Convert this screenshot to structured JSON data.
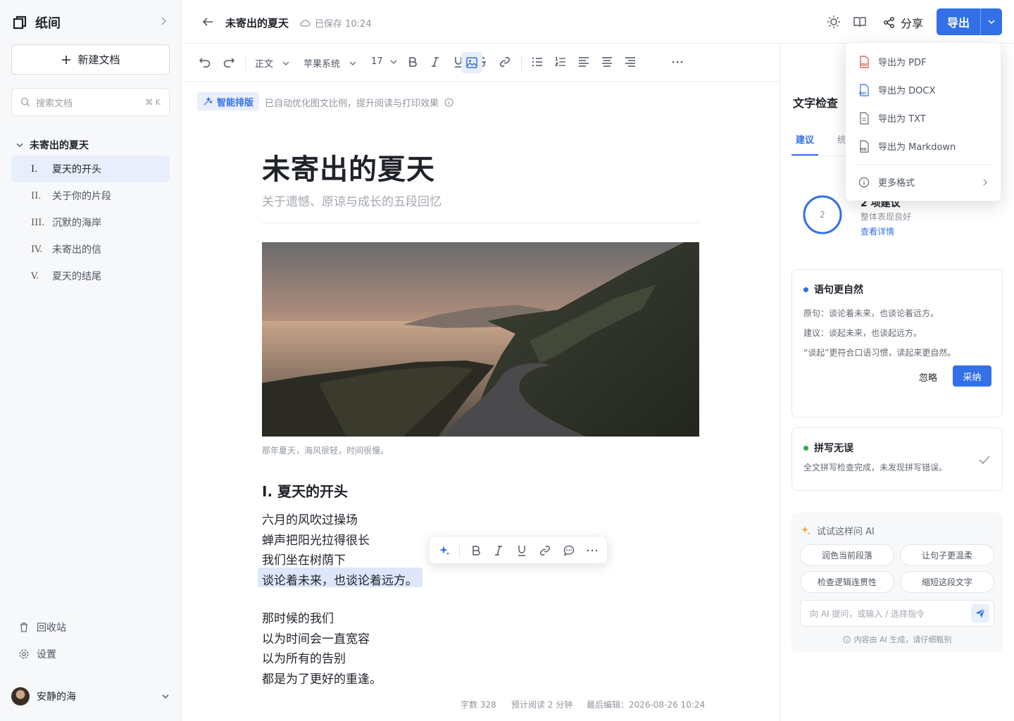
{
  "app": {
    "name": "纸间"
  },
  "sidebar": {
    "new_doc": "新建文档",
    "search_placeholder": "搜索文档",
    "search_shortcut": "⌘ K",
    "doc_title": "未寄出的夏天",
    "outline": [
      {
        "num": "I.",
        "label": "夏天的开头",
        "active": true
      },
      {
        "num": "II.",
        "label": "关于你的片段"
      },
      {
        "num": "III.",
        "label": "沉默的海岸"
      },
      {
        "num": "IV.",
        "label": "未寄出的信"
      },
      {
        "num": "V.",
        "label": "夏天的结尾"
      }
    ],
    "trash": "回收站",
    "settings": "设置",
    "user": "安静的海"
  },
  "topbar": {
    "title": "未寄出的夏天",
    "saved": "已保存 10:24",
    "share": "分享",
    "export": "导出"
  },
  "toolbar": {
    "style": "正文",
    "font": "苹果系统",
    "size": "17"
  },
  "smart": {
    "label": "智能排版",
    "tip": "已自动优化图文比例，提升阅读与打印效果"
  },
  "doc": {
    "title": "未寄出的夏天",
    "subtitle": "关于遗憾、原谅与成长的五段回忆",
    "caption": "那年夏天，海风很轻，时间很慢。",
    "section": "I. 夏天的开头",
    "lines": [
      "六月的风吹过操场",
      "蝉声把阳光拉得很长",
      "我们坐在树荫下",
      "谈论着未来，也谈论着远方。",
      "那时候的我们",
      "以为时间会一直宽容",
      "以为所有的告别",
      "都是为了更好的重逢。"
    ]
  },
  "stats": {
    "words": "字数 328",
    "read": "预计阅读 2 分钟",
    "edited": "最后编辑：2026-08-26 10:24"
  },
  "panel": {
    "title": "文字检查",
    "tab_suggest": "建议",
    "tab_other": "统",
    "score_value": "2",
    "score_title": "2 项建议",
    "score_sub": "整体表现良好",
    "score_link": "查看详情",
    "card1": {
      "title": "语句更自然",
      "orig": "原句：谈论着未来，也谈论着远方。",
      "suggest": "建议：谈起未来，也谈起远方。",
      "reason": "“谈起”更符合口语习惯，读起来更自然。",
      "ignore": "忽略",
      "accept": "采纳"
    },
    "card2": {
      "title": "拼写无误",
      "desc": "全文拼写检查完成，未发现拼写错误。"
    },
    "ai": {
      "title": "试试这样问 AI",
      "chips": [
        "润色当前段落",
        "让句子更温柔",
        "检查逻辑连贯性",
        "缩短这段文字"
      ],
      "placeholder": "向 AI 提问，或输入 / 选择指令",
      "foot": "内容由 AI 生成，请仔细甄别"
    }
  },
  "export_menu": {
    "items": [
      "导出为 PDF",
      "导出为 DOCX",
      "导出为 TXT",
      "导出为 Markdown"
    ],
    "more": "更多格式"
  },
  "colors": {
    "accent": "#3370e8",
    "ok": "#34a853",
    "pdf": "#e5483f"
  }
}
